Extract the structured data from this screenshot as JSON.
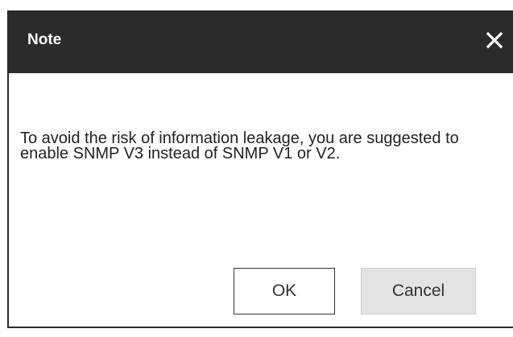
{
  "dialog": {
    "title": "Note",
    "close_icon": "close-icon",
    "message": "To avoid the risk of information leakage, you are suggested to enable SNMP V3 instead of SNMP V1 or V2.",
    "buttons": {
      "ok_label": "OK",
      "cancel_label": "Cancel"
    }
  },
  "colors": {
    "titlebar_bg": "#2b2b2b",
    "title_text": "#ffffff",
    "cancel_bg": "#e3e3e3",
    "ok_border": "#333333"
  }
}
